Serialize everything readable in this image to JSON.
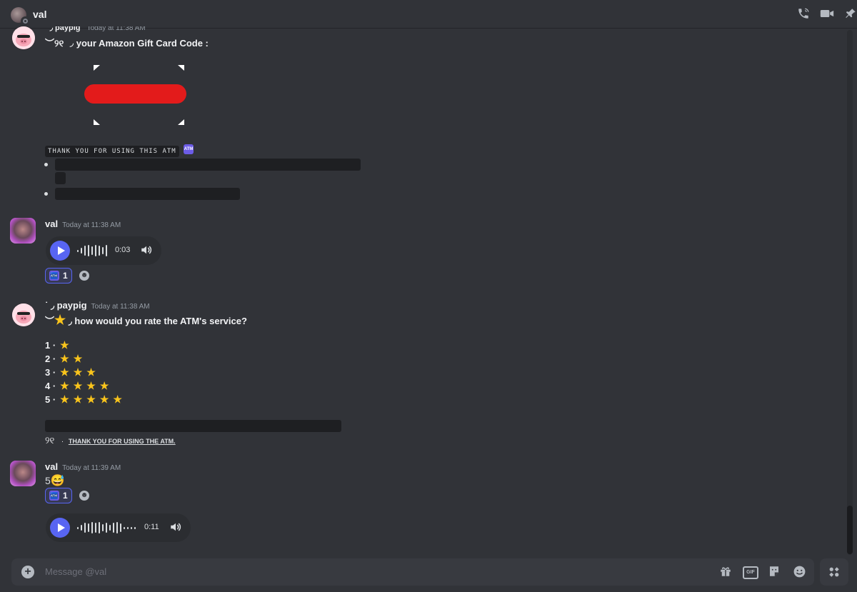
{
  "header": {
    "dm_name": "val",
    "icons": [
      "phone-call-icon",
      "video-call-icon",
      "pin-icon"
    ]
  },
  "messages": [
    {
      "author": "paypig",
      "author_prefix": "˙ ◞",
      "timestamp": "Today at 11:38 AM",
      "line": "︶୨୧ ◞  your Amazon Gift Card Code :",
      "footer_label": "THANK YOU FOR USING THIS ATM",
      "footer_emoji": "ATM"
    },
    {
      "author": "val",
      "timestamp": "Today at 11:38 AM",
      "voice": {
        "duration": "0:03"
      },
      "reaction": {
        "emoji": "ATM",
        "count": "1"
      }
    },
    {
      "author": "paypig",
      "author_prefix": "˙ ◞",
      "timestamp": "Today at 11:38 AM",
      "line_prefix": "︶",
      "line": " ◞  how would you rate the ATM's service?",
      "ratings": [
        {
          "num": "1",
          "stars": 1
        },
        {
          "num": "2",
          "stars": 2
        },
        {
          "num": "3",
          "stars": 3
        },
        {
          "num": "4",
          "stars": 4
        },
        {
          "num": "5",
          "stars": 5
        }
      ],
      "rating_sep": "·",
      "bow": "୨୧",
      "thanks": "THANK YOU FOR USING THE ATM."
    },
    {
      "author": "val",
      "timestamp": "Today at 11:39 AM",
      "text": "5",
      "text_emoji": "😅",
      "reaction": {
        "emoji": "ATM",
        "count": "1"
      },
      "voice": {
        "duration": "0:11"
      }
    }
  ],
  "composer": {
    "placeholder": "Message @val",
    "gif_label": "GIF",
    "icons": [
      "add-attachment-icon",
      "gift-icon",
      "gif-icon",
      "sticker-icon",
      "emoji-icon",
      "apps-icon"
    ]
  },
  "colors": {
    "background": "#313338",
    "accent": "#5865f2",
    "redact_red": "#e31b1b",
    "star": "#f9c41c"
  }
}
